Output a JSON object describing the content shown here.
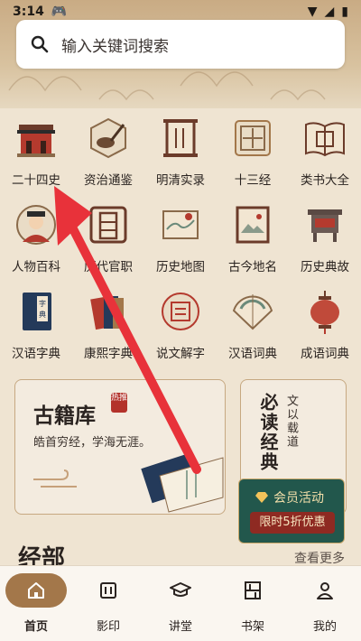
{
  "status": {
    "time": "3:14"
  },
  "search": {
    "placeholder": "输入关键词搜索"
  },
  "grid": [
    [
      {
        "label": "二十四史",
        "icon": "palace-gate-icon"
      },
      {
        "label": "资治通鉴",
        "icon": "ink-brush-icon"
      },
      {
        "label": "明清实录",
        "icon": "scroll-icon"
      },
      {
        "label": "十三经",
        "icon": "classic-seal-icon"
      },
      {
        "label": "类书大全",
        "icon": "open-book-icon"
      }
    ],
    [
      {
        "label": "人物百科",
        "icon": "scholar-portrait-icon"
      },
      {
        "label": "历代官职",
        "icon": "official-seal-icon"
      },
      {
        "label": "历史地图",
        "icon": "map-scroll-icon"
      },
      {
        "label": "古今地名",
        "icon": "landscape-painting-icon"
      },
      {
        "label": "历史典故",
        "icon": "bronze-vessel-icon"
      }
    ],
    [
      {
        "label": "汉语字典",
        "icon": "dictionary-book-icon"
      },
      {
        "label": "康熙字典",
        "icon": "stacked-books-icon"
      },
      {
        "label": "说文解字",
        "icon": "seal-character-icon"
      },
      {
        "label": "汉语词典",
        "icon": "fan-icon"
      },
      {
        "label": "成语词典",
        "icon": "lantern-icon"
      }
    ]
  ],
  "library_card": {
    "title": "古籍库",
    "hot_badge": "热推",
    "subtitle": "皓首穷经，学海无涯。"
  },
  "must_read_card": {
    "title": "必读经典",
    "subtitle": "文以载道"
  },
  "promo": {
    "title": "会员活动",
    "badge": "限时5折优惠"
  },
  "section": {
    "title": "经部",
    "see_more": "查看更多"
  },
  "nav": [
    {
      "label": "首页",
      "icon": "home-icon",
      "active": true
    },
    {
      "label": "影印",
      "icon": "print-icon",
      "active": false
    },
    {
      "label": "讲堂",
      "icon": "graduation-cap-icon",
      "active": false
    },
    {
      "label": "书架",
      "icon": "bookshelf-icon",
      "active": false
    },
    {
      "label": "我的",
      "icon": "profile-icon",
      "active": false
    }
  ],
  "colors": {
    "accent": "#a3774a",
    "annotation_arrow": "#e8323a",
    "promo_bg": "#22574c",
    "promo_badge": "#8e2a22"
  }
}
